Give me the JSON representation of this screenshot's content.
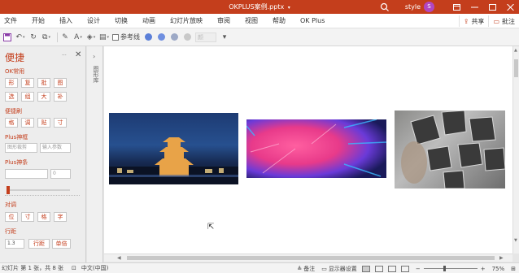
{
  "titlebar": {
    "filename": "OKPLUS案例.pptx",
    "caret": "▾",
    "username": "style",
    "avatar_letter": "S"
  },
  "menu": {
    "items": [
      "文件",
      "开始",
      "插入",
      "设计",
      "切换",
      "动画",
      "幻灯片放映",
      "审阅",
      "视图",
      "帮助",
      "OK Plus"
    ],
    "share_label": "共享",
    "comment_label": "批注"
  },
  "toolbar": {
    "guide_label": "参考线",
    "select_value": "颜"
  },
  "panel": {
    "title": "便捷",
    "option_label": "···",
    "ok_section": "OK常用",
    "ok_row1": [
      "形",
      "复",
      "批",
      "图"
    ],
    "ok_row2": [
      "选",
      "组",
      "大",
      "补"
    ],
    "quick_section": "便捷刷",
    "quick_row": [
      "格",
      "调",
      "贴",
      "寸"
    ],
    "shape_section": "Plus神框",
    "shape_input_value": "图形裁剪",
    "shape_input_placeholder": "输入参数",
    "bar_section": "Plus神条",
    "bar_input_value": "0",
    "align_section": "对调",
    "align_row": [
      "位",
      "寸",
      "格",
      "字"
    ],
    "spacing_section": "行距",
    "spacing_value": "1.3",
    "spacing_btn1": "行距",
    "spacing_btn2": "单倍"
  },
  "collapsed_pane": {
    "arrow": "›",
    "label": "图形库"
  },
  "statusbar": {
    "slide_info": "幻灯片 第 1 张，共 8 张",
    "language": "中文(中国)",
    "notes_label": "备注",
    "display_label": "显示器设置",
    "zoom": "75%"
  },
  "colors": {
    "accent": "#c43e1c",
    "avatar": "#b146c2"
  }
}
